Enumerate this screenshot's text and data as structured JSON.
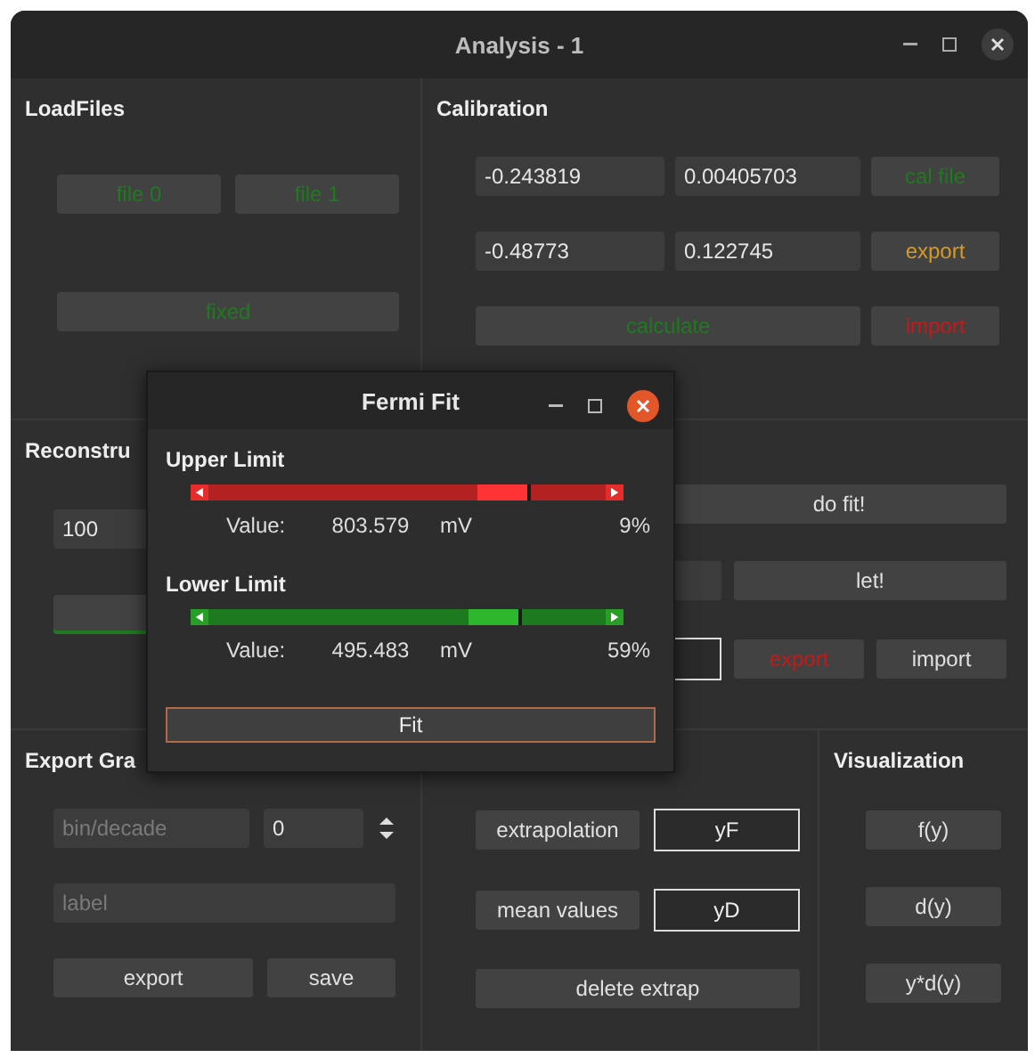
{
  "window": {
    "title": "Analysis - 1"
  },
  "load_files": {
    "title": "LoadFiles",
    "buttons": [
      {
        "label": "file 0",
        "color": "#1f7a1f"
      },
      {
        "label": "file 1",
        "color": "#1f7a1f"
      },
      {
        "label": "fixed",
        "color": "#1f7a1f"
      }
    ]
  },
  "calibration": {
    "title": "Calibration",
    "rows": [
      {
        "values": [
          "-0.243819",
          "0.00405703"
        ],
        "button": {
          "label": "cal file",
          "color": "#1f7a1f"
        }
      },
      {
        "values": [
          "-0.48773",
          "0.122745"
        ],
        "button": {
          "label": "export",
          "color": "#d49a2a"
        }
      }
    ],
    "wide_button": {
      "label": "calculate",
      "color": "#1f7a1f"
    },
    "side_button": {
      "label": "import",
      "color": "#c81818"
    }
  },
  "reconstruction": {
    "title": "Reconstru",
    "value": "100",
    "button": {
      "color": "#1f7a1f"
    }
  },
  "fit_panel": {
    "buttons": [
      {
        "label": "do fit!",
        "color": "#e0e0e0"
      },
      {
        "label": "let!",
        "color": "#e0e0e0"
      },
      {
        "label": "export",
        "color": "#c81818"
      },
      {
        "label": "import",
        "color": "#e0e0e0"
      }
    ]
  },
  "export_graph": {
    "title": "Export Gra",
    "bin_placeholder": "bin/decade",
    "bin_value": "0",
    "label_placeholder": "label",
    "buttons": [
      "export",
      "save"
    ]
  },
  "extrapolation": {
    "rows": [
      {
        "label": "extrapolation",
        "value": "yF"
      },
      {
        "label": "mean values",
        "value": "yD"
      }
    ],
    "button": "delete extrap"
  },
  "visualization": {
    "title": "Visualization",
    "buttons": [
      "f(y)",
      "d(y)",
      "y*d(y)"
    ]
  },
  "dialog": {
    "title": "Fermi Fit",
    "limits": [
      {
        "name": "Upper Limit",
        "color": "#b22222",
        "level": 0.72,
        "value_label": "Value:",
        "value": "803.579",
        "unit": "mV",
        "percent": "9%"
      },
      {
        "name": "Lower Limit",
        "color": "#1e7a1e",
        "level": 0.7,
        "value_label": "Value:",
        "value": "495.483",
        "unit": "mV",
        "percent": "59%"
      }
    ],
    "button": "Fit"
  }
}
